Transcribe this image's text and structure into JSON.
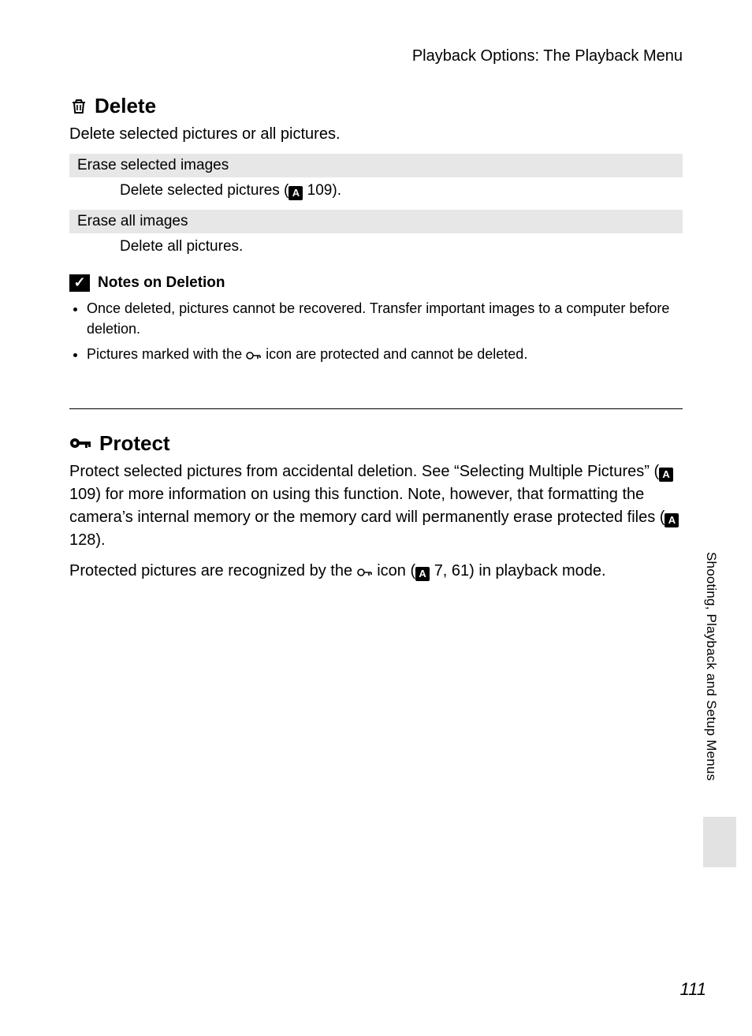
{
  "running_head": "Playback Options: The Playback Menu",
  "delete": {
    "title": "Delete",
    "lead": "Delete selected pictures or all pictures.",
    "opt1_head": "Erase selected images",
    "opt1_desc_a": "Delete selected pictures (",
    "opt1_ref": "109",
    "opt1_desc_b": ").",
    "opt2_head": "Erase all images",
    "opt2_desc": "Delete all pictures."
  },
  "notes": {
    "title": "Notes on Deletion",
    "item1": "Once deleted, pictures cannot be recovered. Transfer important images to a computer before deletion.",
    "item2_a": "Pictures marked with the ",
    "item2_b": " icon are protected and cannot be deleted."
  },
  "protect": {
    "title": "Protect",
    "p1_a": "Protect selected pictures from accidental deletion. See “Selecting Multiple Pictures” (",
    "p1_ref1": "109",
    "p1_b": ") for more information on using this function. Note, however, that formatting the camera’s internal memory or the memory card will permanently erase protected files (",
    "p1_ref2": "128",
    "p1_c": ").",
    "p2_a": "Protected pictures are recognized by the ",
    "p2_b": " icon (",
    "p2_ref": "7, 61",
    "p2_c": ") in playback mode."
  },
  "side_tab": "Shooting, Playback and Setup Menus",
  "page_number": "111",
  "ref_glyph": "A"
}
